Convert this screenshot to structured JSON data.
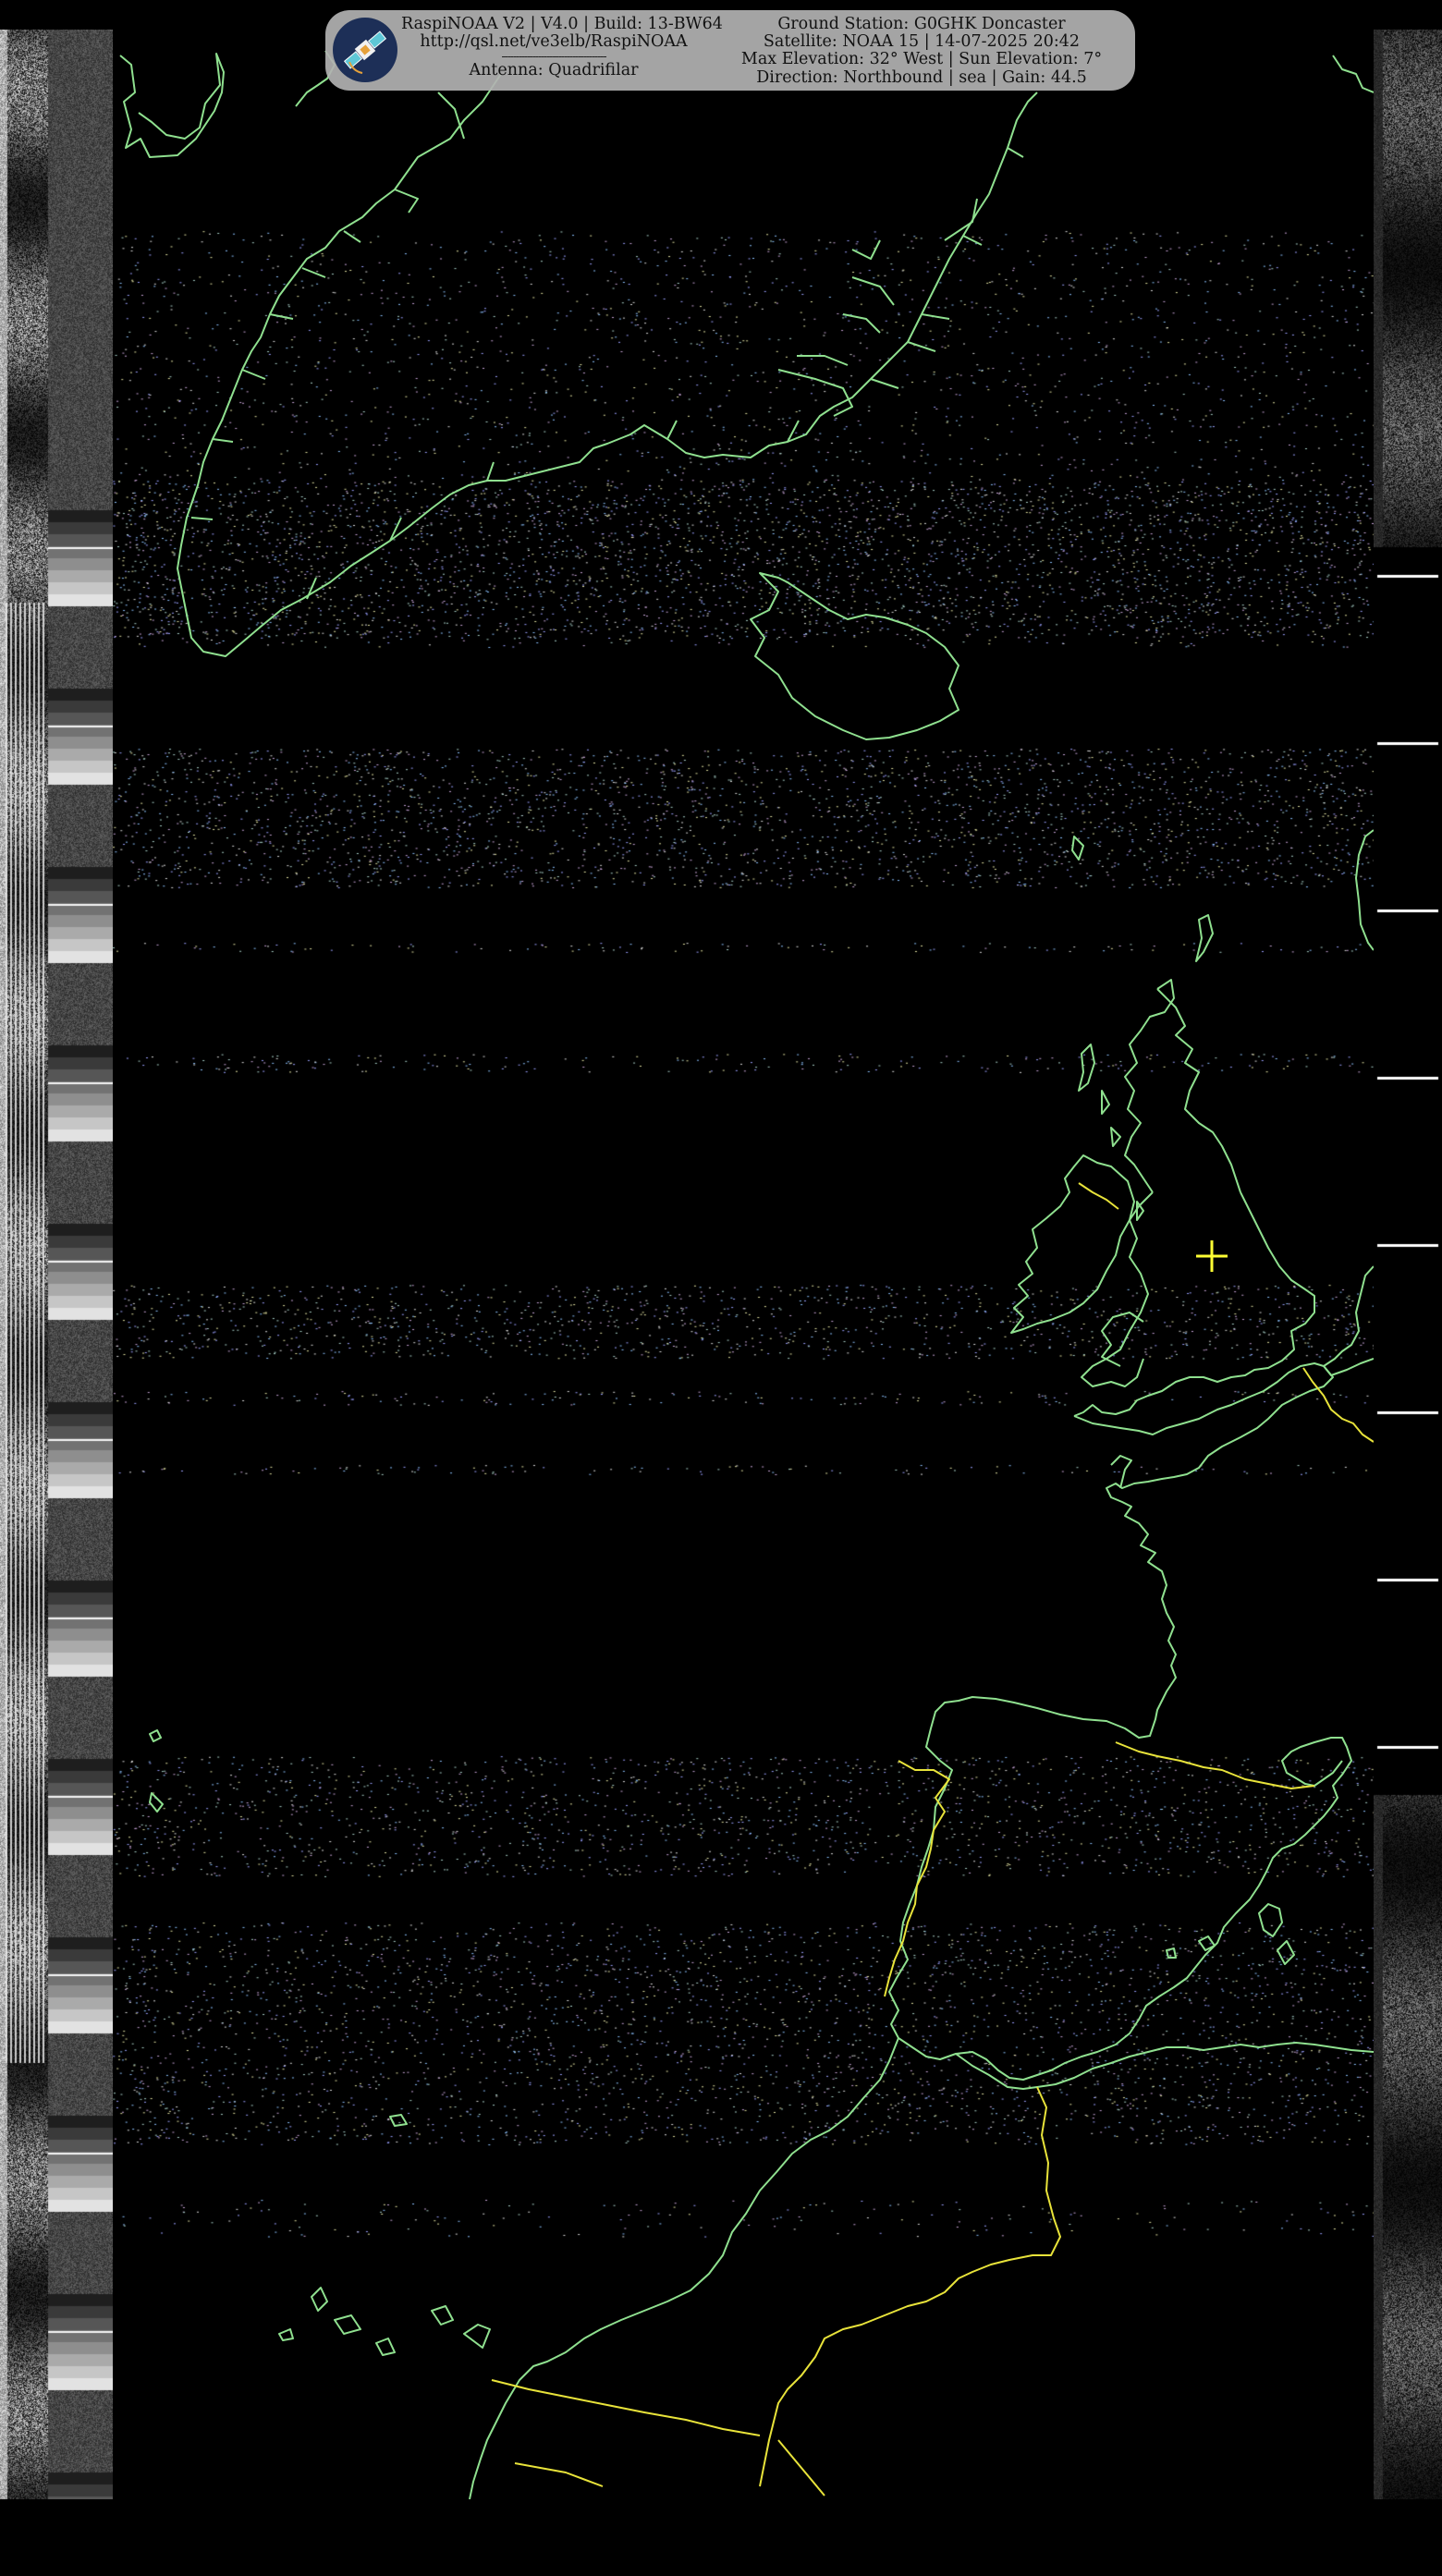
{
  "header": {
    "software_line": "RaspiNOAA V2 | V4.0 | Build: 13-BW64",
    "url_line": "http://qsl.net/ve3elb/RaspiNOAA",
    "separator": "-------------------------------------",
    "antenna_line": "Antenna: Quadrifilar",
    "station_line": "Ground Station: G0GHK Doncaster",
    "satellite_line": "Satellite: NOAA 15 | 14-07-2025 20:42",
    "elevation_line": "Max Elevation: 32° West | Sun Elevation: 7°",
    "direction_line": "Direction: Northbound | sea | Gain: 44.5"
  },
  "logo": {
    "icon": "satellite-icon"
  },
  "image": {
    "type": "NOAA APT weather satellite image, sea-surface-temperature style enhancement",
    "colors": {
      "background": "#000000",
      "coastline": "#8fe08f",
      "borders": "#e8e33a",
      "ground_station_marker": "#ffff33",
      "header_panel": "#b2b2b2"
    },
    "marker_icon": "crosshair-icon"
  }
}
